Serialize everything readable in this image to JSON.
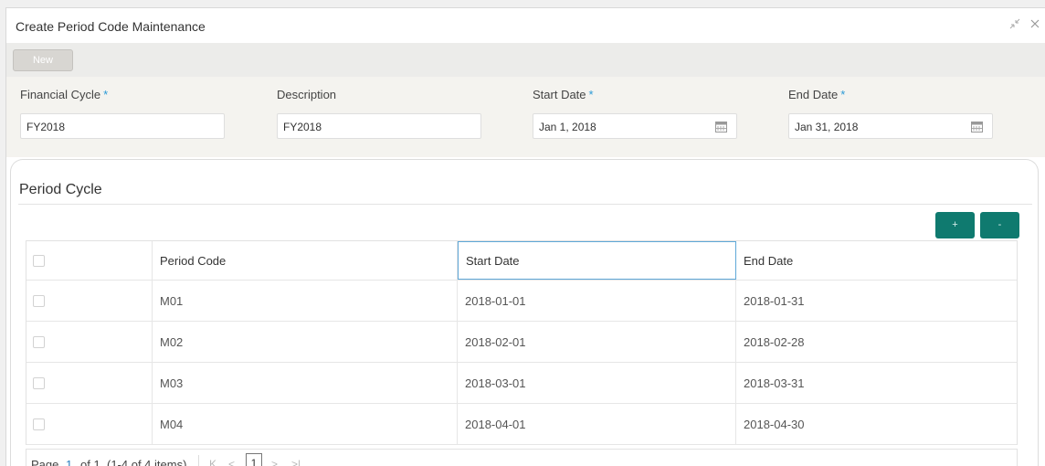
{
  "window": {
    "title": "Create Period Code Maintenance",
    "minimize_icon": "compress-icon",
    "close_icon": "close-icon"
  },
  "toolbar": {
    "new_label": "New"
  },
  "form": {
    "financial_cycle": {
      "label": "Financial Cycle",
      "required": "*",
      "value": "FY2018"
    },
    "description": {
      "label": "Description",
      "value": "FY2018"
    },
    "start_date": {
      "label": "Start Date",
      "required": "*",
      "value": "Jan 1, 2018",
      "icon": "calendar-icon"
    },
    "end_date": {
      "label": "End Date",
      "required": "*",
      "value": "Jan 31, 2018",
      "icon": "calendar-icon"
    }
  },
  "period_cycle": {
    "title": "Period Cycle",
    "add_label": "+",
    "remove_label": "-",
    "columns": [
      "Period Code",
      "Start Date",
      "End Date"
    ],
    "rows": [
      {
        "code": "M01",
        "start": "2018-01-01",
        "end": "2018-01-31"
      },
      {
        "code": "M02",
        "start": "2018-02-01",
        "end": "2018-02-28"
      },
      {
        "code": "M03",
        "start": "2018-03-01",
        "end": "2018-03-31"
      },
      {
        "code": "M04",
        "start": "2018-04-01",
        "end": "2018-04-30"
      }
    ]
  },
  "pager": {
    "page_label": "Page",
    "current": "1",
    "of_text": "of 1",
    "items_text": "(1-4 of 4 items)",
    "first": "K",
    "prev": "<",
    "page_box": "1",
    "next": ">",
    "last": ">|"
  },
  "colors": {
    "accent": "#0f7a6f",
    "required": "#2a9ad6",
    "active_border": "#5fa8d8"
  }
}
